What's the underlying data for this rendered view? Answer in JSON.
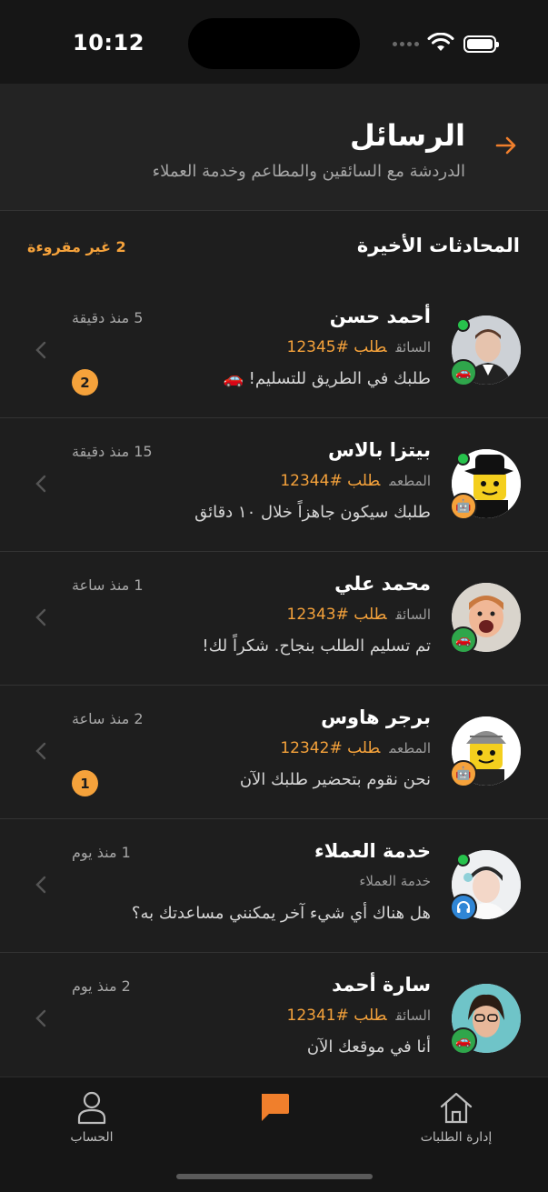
{
  "status": {
    "time": "10:12"
  },
  "header": {
    "title": "الرسائل",
    "subtitle": "الدردشة مع السائقين والمطاعم وخدمة العملاء"
  },
  "section": {
    "title": "المحادثات الأخيرة",
    "unread_label": "2 غير مقروءة"
  },
  "conversations": [
    {
      "name": "أحمد حسن",
      "role": "السائق",
      "order": "طلب #12345",
      "message": "طلبك في الطريق للتسليم! 🚗",
      "time": "5 منذ دقيقة",
      "unread": "2",
      "online": true,
      "badge": "driver"
    },
    {
      "name": "بيتزا بالاس",
      "role": "المطعم",
      "order": "طلب #12344",
      "message": "طلبك سيكون جاهزاً خلال ١٠ دقائق",
      "time": "15 منذ دقيقة",
      "unread": "",
      "online": true,
      "badge": "restaurant"
    },
    {
      "name": "محمد علي",
      "role": "السائق",
      "order": "طلب #12343",
      "message": "تم تسليم الطلب بنجاح. شكراً لك!",
      "time": "1 منذ ساعة",
      "unread": "",
      "online": false,
      "badge": "driver"
    },
    {
      "name": "برجر هاوس",
      "role": "المطعم",
      "order": "طلب #12342",
      "message": "نحن نقوم بتحضير طلبك الآن",
      "time": "2 منذ ساعة",
      "unread": "1",
      "online": false,
      "badge": "restaurant"
    },
    {
      "name": "خدمة العملاء",
      "role": "خدمة العملاء",
      "order": "",
      "message": "هل هناك أي شيء آخر يمكنني مساعدتك به؟",
      "time": "1 منذ يوم",
      "unread": "",
      "online": true,
      "badge": "support"
    },
    {
      "name": "سارة أحمد",
      "role": "السائق",
      "order": "طلب #12341",
      "message": "أنا في موقعك الآن",
      "time": "2 منذ يوم",
      "unread": "",
      "online": false,
      "badge": "driver"
    }
  ],
  "tabs": {
    "account": "الحساب",
    "messages": "",
    "orders": "إدارة الطلبات"
  },
  "colors": {
    "accent": "#f5a23b",
    "online": "#27c24c",
    "background": "#1e1e1e"
  }
}
